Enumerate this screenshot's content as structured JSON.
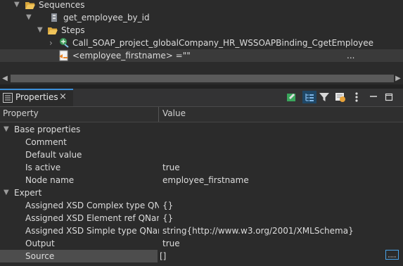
{
  "tree": {
    "items": [
      {
        "label": "Sequences",
        "icon": "folder-open-icon"
      },
      {
        "label": "get_employee_by_id",
        "icon": "sequence-icon"
      },
      {
        "label": "Steps",
        "icon": "folder-open-icon"
      },
      {
        "label": "Call_SOAP_project_globalCompany_HR_WSSOAPBinding_CgetEmployee",
        "icon": "soap-call-icon"
      },
      {
        "label": "<employee_firstname> =\"\"",
        "icon": "element-step-icon"
      }
    ],
    "ellipsis": "..."
  },
  "panel": {
    "tab_label": "Properties",
    "close_glyph": "×",
    "toolbar": [
      "pin-icon",
      "show-categories-icon",
      "filter-icon",
      "restore-default-icon",
      "view-menu-icon",
      "minimize-icon",
      "maximize-icon"
    ]
  },
  "columns": {
    "property": "Property",
    "value": "Value"
  },
  "groups": [
    {
      "label": "Base properties",
      "rows": [
        {
          "name": "Comment",
          "value": ""
        },
        {
          "name": "Default value",
          "value": ""
        },
        {
          "name": "Is active",
          "value": "true"
        },
        {
          "name": "Node name",
          "value": "employee_firstname"
        }
      ]
    },
    {
      "label": "Expert",
      "rows": [
        {
          "name": "Assigned XSD Complex type QName",
          "value": "{}"
        },
        {
          "name": "Assigned XSD Element ref QName",
          "value": "{}"
        },
        {
          "name": "Assigned XSD Simple type QName",
          "value": "string{http://www.w3.org/2001/XMLSchema}"
        },
        {
          "name": "Output",
          "value": "true"
        },
        {
          "name": "Source",
          "value": "[]"
        }
      ]
    }
  ]
}
